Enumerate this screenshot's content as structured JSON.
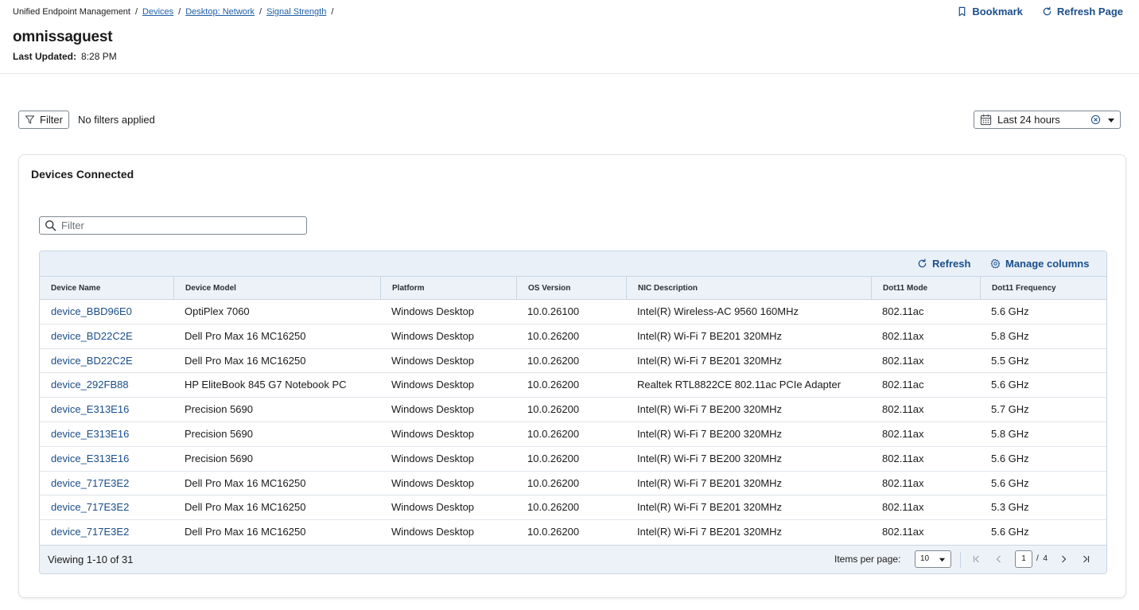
{
  "breadcrumb": {
    "root": "Unified Endpoint Management",
    "links": [
      "Devices",
      "Desktop: Network",
      "Signal Strength"
    ],
    "separator": "/"
  },
  "header": {
    "title": "omnissaguest",
    "last_updated_label": "Last Updated:",
    "last_updated_value": "8:28 PM",
    "bookmark_label": "Bookmark",
    "refresh_page_label": "Refresh Page"
  },
  "filter_bar": {
    "filter_label": "Filter",
    "status": "No filters applied",
    "date_range": "Last 24 hours"
  },
  "card": {
    "title": "Devices Connected",
    "search_placeholder": "Filter",
    "refresh_label": "Refresh",
    "manage_columns_label": "Manage columns"
  },
  "table": {
    "columns": [
      "Device Name",
      "Device Model",
      "Platform",
      "OS Version",
      "NIC Description",
      "Dot11 Mode",
      "Dot11 Frequency"
    ],
    "rows": [
      [
        "device_BBD96E0",
        "OptiPlex 7060",
        "Windows Desktop",
        "10.0.26100",
        "Intel(R) Wireless-AC 9560 160MHz",
        "802.11ac",
        "5.6 GHz"
      ],
      [
        "device_BD22C2E",
        "Dell Pro Max 16 MC16250",
        "Windows Desktop",
        "10.0.26200",
        "Intel(R) Wi-Fi 7 BE201 320MHz",
        "802.11ax",
        "5.8 GHz"
      ],
      [
        "device_BD22C2E",
        "Dell Pro Max 16 MC16250",
        "Windows Desktop",
        "10.0.26200",
        "Intel(R) Wi-Fi 7 BE201 320MHz",
        "802.11ax",
        "5.5 GHz"
      ],
      [
        "device_292FB88",
        "HP EliteBook 845 G7 Notebook PC",
        "Windows Desktop",
        "10.0.26200",
        "Realtek RTL8822CE 802.11ac PCIe Adapter",
        "802.11ac",
        "5.6 GHz"
      ],
      [
        "device_E313E16",
        "Precision 5690",
        "Windows Desktop",
        "10.0.26200",
        "Intel(R) Wi-Fi 7 BE200 320MHz",
        "802.11ax",
        "5.7 GHz"
      ],
      [
        "device_E313E16",
        "Precision 5690",
        "Windows Desktop",
        "10.0.26200",
        "Intel(R) Wi-Fi 7 BE200 320MHz",
        "802.11ax",
        "5.8 GHz"
      ],
      [
        "device_E313E16",
        "Precision 5690",
        "Windows Desktop",
        "10.0.26200",
        "Intel(R) Wi-Fi 7 BE200 320MHz",
        "802.11ax",
        "5.6 GHz"
      ],
      [
        "device_717E3E2",
        "Dell Pro Max 16 MC16250",
        "Windows Desktop",
        "10.0.26200",
        "Intel(R) Wi-Fi 7 BE201 320MHz",
        "802.11ax",
        "5.6 GHz"
      ],
      [
        "device_717E3E2",
        "Dell Pro Max 16 MC16250",
        "Windows Desktop",
        "10.0.26200",
        "Intel(R) Wi-Fi 7 BE201 320MHz",
        "802.11ax",
        "5.3 GHz"
      ],
      [
        "device_717E3E2",
        "Dell Pro Max 16 MC16250",
        "Windows Desktop",
        "10.0.26200",
        "Intel(R) Wi-Fi 7 BE201 320MHz",
        "802.11ax",
        "5.6 GHz"
      ]
    ]
  },
  "footer": {
    "viewing": "Viewing 1-10 of 31",
    "items_per_page_label": "Items per page:",
    "items_per_page_value": "10",
    "current_page": "1",
    "page_separator": "/",
    "total_pages": "4"
  },
  "icons": {
    "bookmark": "bookmark-icon",
    "refresh": "refresh-icon",
    "filter": "filter-icon",
    "calendar": "calendar-icon",
    "clear": "clear-circle-icon",
    "caret": "caret-down-icon",
    "search": "search-icon",
    "gear": "gear-icon",
    "first_page": "first-page-icon",
    "prev_page": "chevron-left-icon",
    "next_page": "chevron-right-icon",
    "last_page": "last-page-icon"
  },
  "colors": {
    "link": "#1a4e8a",
    "toolbar_bg": "#e9f0f8",
    "border": "#c9d5e3"
  }
}
